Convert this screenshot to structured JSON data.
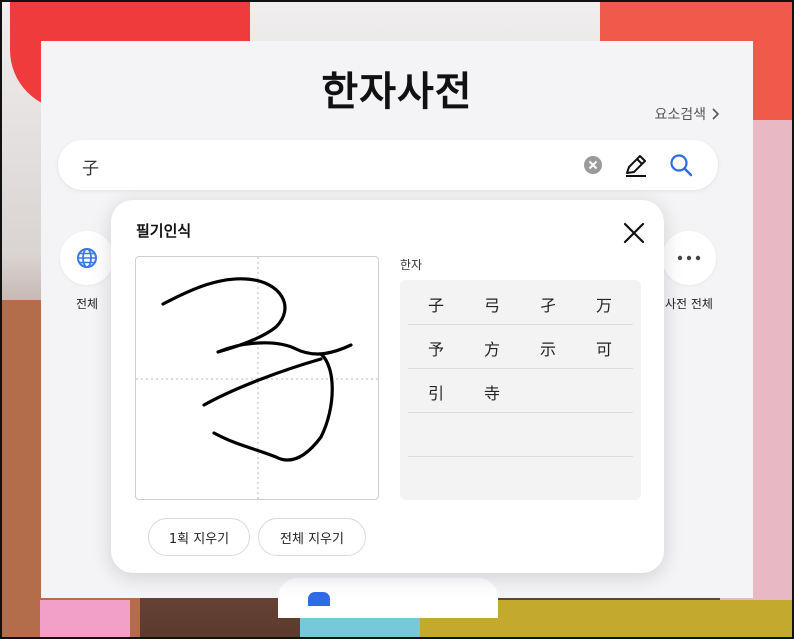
{
  "app": {
    "title": "한자사전",
    "element_search_label": "요소검색"
  },
  "search": {
    "value": "子"
  },
  "shortcuts": [
    {
      "label": "전체"
    },
    {
      "label": "사전 전체"
    }
  ],
  "handwriting": {
    "title": "필기인식",
    "candidates_label": "한자",
    "candidates": [
      [
        "子",
        "弓",
        "孑",
        "万"
      ],
      [
        "予",
        "方",
        "示",
        "可"
      ],
      [
        "引",
        "寺"
      ]
    ],
    "undo_stroke_label": "1획 지우기",
    "clear_all_label": "전체 지우기"
  },
  "colors": {
    "accent": "#2f6be6",
    "panel_bg": "#f4f4f7"
  }
}
